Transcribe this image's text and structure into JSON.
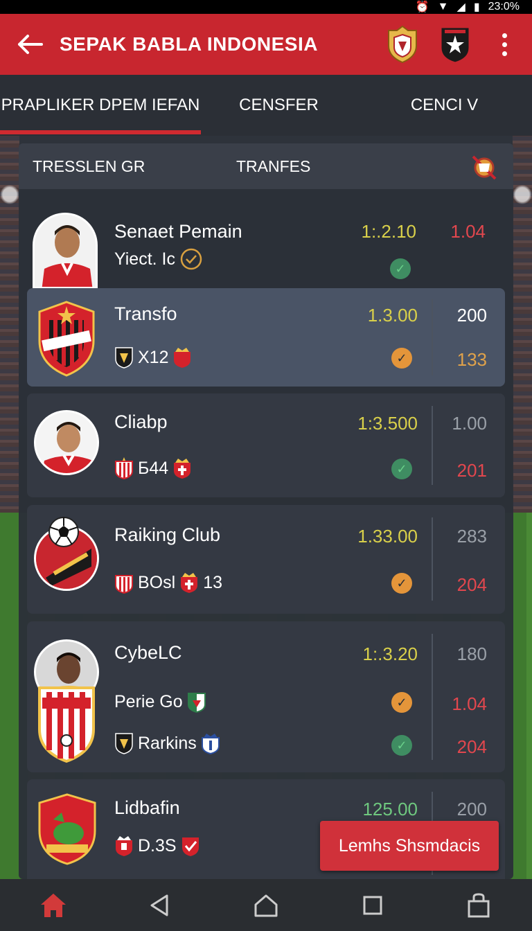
{
  "status_bar": {
    "time": "23:0%"
  },
  "app_bar": {
    "title": "SEPAK BABLA INDONESIA",
    "back_icon": "arrow-left-icon",
    "more_icon": "more-vertical-icon"
  },
  "tabs": [
    {
      "label": "PRAPLIKER DPEM IEFAN",
      "active": true
    },
    {
      "label": "CENSFER",
      "active": false
    },
    {
      "label": "CENCI V",
      "active": false
    }
  ],
  "filter_bar": {
    "label_1": "TRESSLEN GR",
    "label_2": "TRANFES",
    "icon": "trophy-icon"
  },
  "rows": [
    {
      "name": "Senaet Pemain",
      "sub": "Yiect. Ic",
      "odd": "1:.2.10",
      "value_top": "1.04",
      "value_bottom": ""
    },
    {
      "name": "Transfo",
      "sub": "X12",
      "odd": "1.3.00",
      "value_top": "200",
      "value_bottom": "133"
    },
    {
      "name": "Cliabp",
      "sub": "Б44",
      "odd": "1:3.500",
      "value_top": "1.00",
      "value_bottom": "201"
    },
    {
      "name": "Raiking Club",
      "sub": "BOsl",
      "sub_extra": "13",
      "odd": "1.33.00",
      "value_top": "283",
      "value_bottom": "204"
    },
    {
      "name": "CybeLC",
      "sub": "Perie Go",
      "sub_2": "Rarkins",
      "odd": "1:.3.20",
      "value_top": "180",
      "value_mid": "1.04",
      "value_bottom": "204"
    },
    {
      "name": "Lidbafin",
      "sub": "D.3S",
      "odd": "125.00",
      "value_top": "200"
    }
  ],
  "cta": {
    "label": "Lemhs Shsmdacis"
  },
  "nav": [
    {
      "icon": "home-icon"
    },
    {
      "icon": "back-triangle-icon"
    },
    {
      "icon": "home-outline-icon"
    },
    {
      "icon": "recents-square-icon"
    },
    {
      "icon": "bag-icon"
    }
  ],
  "colors": {
    "brand_red": "#c8262f",
    "odd_yellow": "#d9d04a",
    "odd_green": "#6fc87f",
    "value_red": "#e2474e"
  }
}
